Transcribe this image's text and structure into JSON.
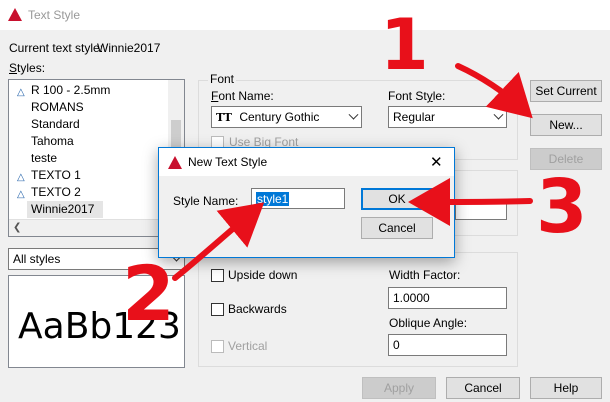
{
  "window": {
    "title": "Text Style"
  },
  "current_style": {
    "label": "Current text style:",
    "value": "Winnie2017"
  },
  "styles": {
    "label": "Styles:",
    "items": [
      {
        "label": "R 100 - 2.5mm",
        "annotative": true
      },
      {
        "label": "ROMANS",
        "annotative": false
      },
      {
        "label": "Standard",
        "annotative": false
      },
      {
        "label": "Tahoma",
        "annotative": false
      },
      {
        "label": "teste",
        "annotative": false
      },
      {
        "label": "TEXTO 1",
        "annotative": true
      },
      {
        "label": "TEXTO 2",
        "annotative": true
      },
      {
        "label": "Winnie2017",
        "annotative": false,
        "selected": true
      }
    ],
    "filter": "All styles"
  },
  "preview": {
    "text": "AaBb123"
  },
  "font": {
    "group_label": "Font",
    "name_label": "Font Name:",
    "name_value": "Century Gothic",
    "style_label": "Font Style:",
    "style_value": "Regular",
    "use_big_font": "Use Big Font"
  },
  "effects": {
    "upside_down": "Upside down",
    "backwards": "Backwards",
    "vertical": "Vertical",
    "width_factor_label": "Width Factor:",
    "width_factor_value": "1.0000",
    "oblique_angle_label": "Oblique Angle:",
    "oblique_angle_value": "0"
  },
  "buttons": {
    "set_current": "Set Current",
    "new": "New...",
    "delete": "Delete",
    "apply": "Apply",
    "cancel": "Cancel",
    "help": "Help"
  },
  "new_style_dialog": {
    "title": "New Text Style",
    "close": "✕",
    "name_label": "Style Name:",
    "name_value": "style1",
    "ok": "OK",
    "cancel": "Cancel"
  },
  "annotations": {
    "one": "1",
    "two": "2",
    "three": "3"
  },
  "colors": {
    "accent": "#0078d7",
    "annotation_red": "#e8101a",
    "autocad_red": "#c8102e"
  }
}
